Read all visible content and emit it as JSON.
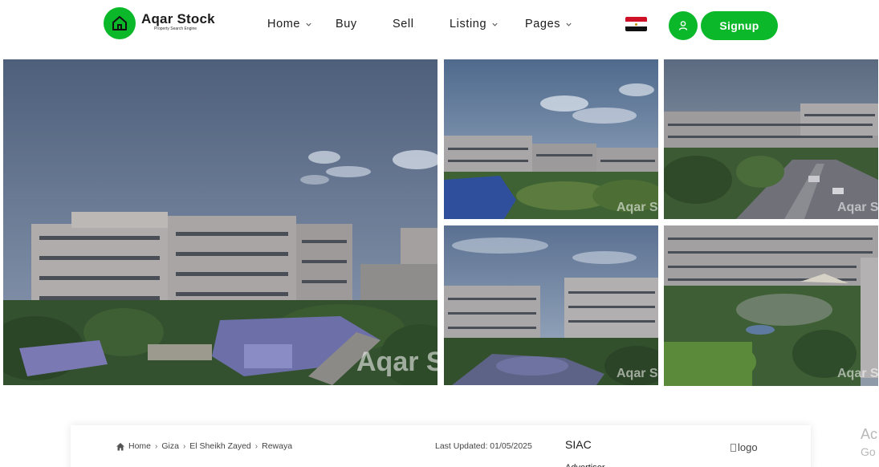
{
  "header": {
    "brand_name": "Aqar Stock",
    "brand_tagline": "Property Search Engine",
    "nav": [
      {
        "label": "Home",
        "dropdown": true
      },
      {
        "label": "Buy",
        "dropdown": false
      },
      {
        "label": "Sell",
        "dropdown": false
      },
      {
        "label": "Listing",
        "dropdown": true
      },
      {
        "label": "Pages",
        "dropdown": true
      }
    ],
    "signup_label": "Signup",
    "language_flag": "egypt-flag-icon"
  },
  "gallery": {
    "watermark": "Aqar Stock",
    "photos": [
      {
        "name": "main-photo"
      },
      {
        "name": "photo-2"
      },
      {
        "name": "photo-3"
      },
      {
        "name": "photo-4"
      },
      {
        "name": "photo-5"
      }
    ]
  },
  "details": {
    "breadcrumb": [
      "Home",
      "Giza",
      "El Sheikh Zayed",
      "Rewaya"
    ],
    "last_updated": "Last Updated: 01/05/2025",
    "developer_name": "SIAC",
    "developer_sub": "Advertiser",
    "logo_alt": "logo"
  },
  "overlay": {
    "activate_line1": "Ac",
    "activate_line2": "Go"
  },
  "colors": {
    "brand_green": "#0ab82a",
    "text_dark": "#1c1c1c"
  }
}
